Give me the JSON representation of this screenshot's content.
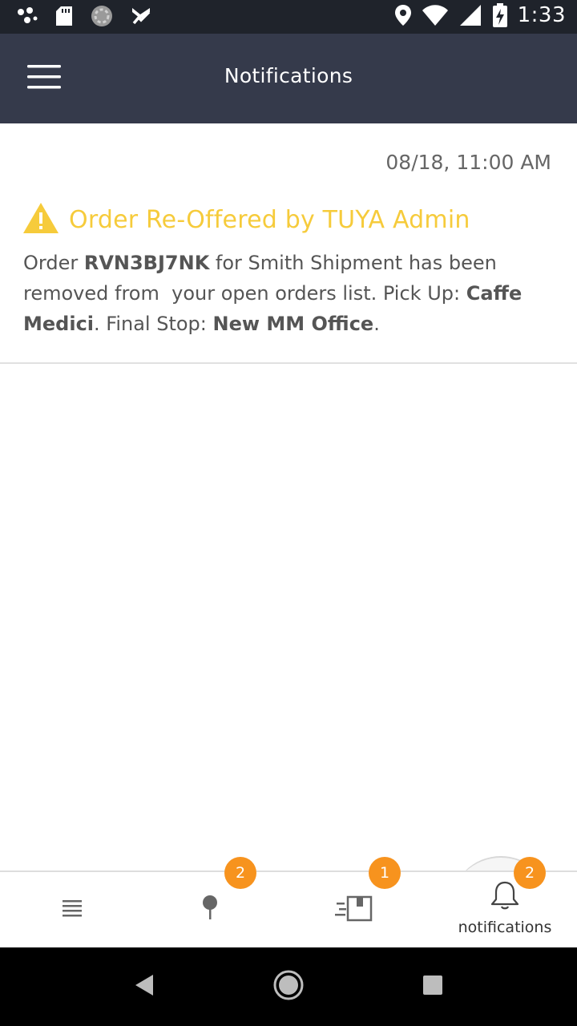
{
  "status_bar": {
    "time": "1:33",
    "icons": [
      "dots-icon",
      "sd-card-icon",
      "sync-icon",
      "check-mail-icon",
      "location-icon",
      "wifi-icon",
      "signal-icon",
      "battery-charging-icon"
    ]
  },
  "header": {
    "title": "Notifications",
    "menu_icon": "hamburger-menu-icon"
  },
  "notification": {
    "timestamp": "08/18, 11:00 AM",
    "icon": "warning-icon",
    "title": "Order Re-Offered by TUYA Admin",
    "body": {
      "t1": "Order ",
      "order_id": "RVN3BJ7NK",
      "t2": " for Smith Shipment has been removed from  your open orders list. Pick Up: ",
      "pickup": "Caffe Medici",
      "t3": ". Final Stop: ",
      "final_stop": "New MM Office",
      "t4": "."
    }
  },
  "tab_bar": {
    "tabs": [
      {
        "icon": "list-icon",
        "badge": ""
      },
      {
        "icon": "map-pin-icon",
        "badge": "2"
      },
      {
        "icon": "delivery-box-icon",
        "badge": "1"
      },
      {
        "icon": "bell-icon",
        "label": "notifications",
        "badge": "2"
      }
    ]
  },
  "colors": {
    "app_bar": "#353a4b",
    "status_bar": "#1f232b",
    "warning": "#f6cb3b",
    "badge": "#f7931e"
  }
}
